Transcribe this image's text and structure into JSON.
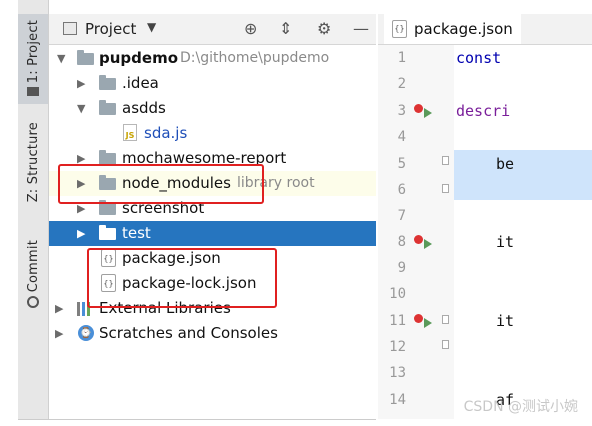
{
  "side_tabs": {
    "project": "1: Project",
    "structure": "Z: Structure",
    "commit": "Commit"
  },
  "project_panel": {
    "title": "Project",
    "tree": [
      {
        "label": "pupdemo",
        "hint": "D:\\githome\\pupdemo",
        "icon": "folder-icon"
      },
      {
        "label": ".idea",
        "icon": "folder-icon"
      },
      {
        "label": "asdds",
        "icon": "folder-icon"
      },
      {
        "label": "sda.js",
        "icon": "js-file-icon"
      },
      {
        "label": "mochawesome-report",
        "icon": "folder-icon"
      },
      {
        "label": "node_modules",
        "hint": "library root",
        "icon": "folder-icon"
      },
      {
        "label": "screenshot",
        "icon": "folder-icon"
      },
      {
        "label": "test",
        "icon": "folder-icon"
      },
      {
        "label": "package.json",
        "icon": "json-file-icon"
      },
      {
        "label": "package-lock.json",
        "icon": "json-file-icon"
      },
      {
        "label": "External Libraries",
        "icon": "library-icon"
      },
      {
        "label": "Scratches and Consoles",
        "icon": "scratch-icon"
      }
    ]
  },
  "editor": {
    "tab": "package.json",
    "lines": [
      "1",
      "2",
      "3",
      "4",
      "5",
      "6",
      "7",
      "8",
      "9",
      "10",
      "11",
      "12",
      "13",
      "14"
    ],
    "code": {
      "l1": "const",
      "l3": "descri",
      "l5": "be",
      "l8": "it",
      "l11": "it",
      "l14": "af"
    }
  },
  "watermark": "CSDN @测试小婉",
  "colors": {
    "selection": "#2675bf",
    "highlight_box": "#e02020",
    "folder": "#9aa7b0"
  }
}
